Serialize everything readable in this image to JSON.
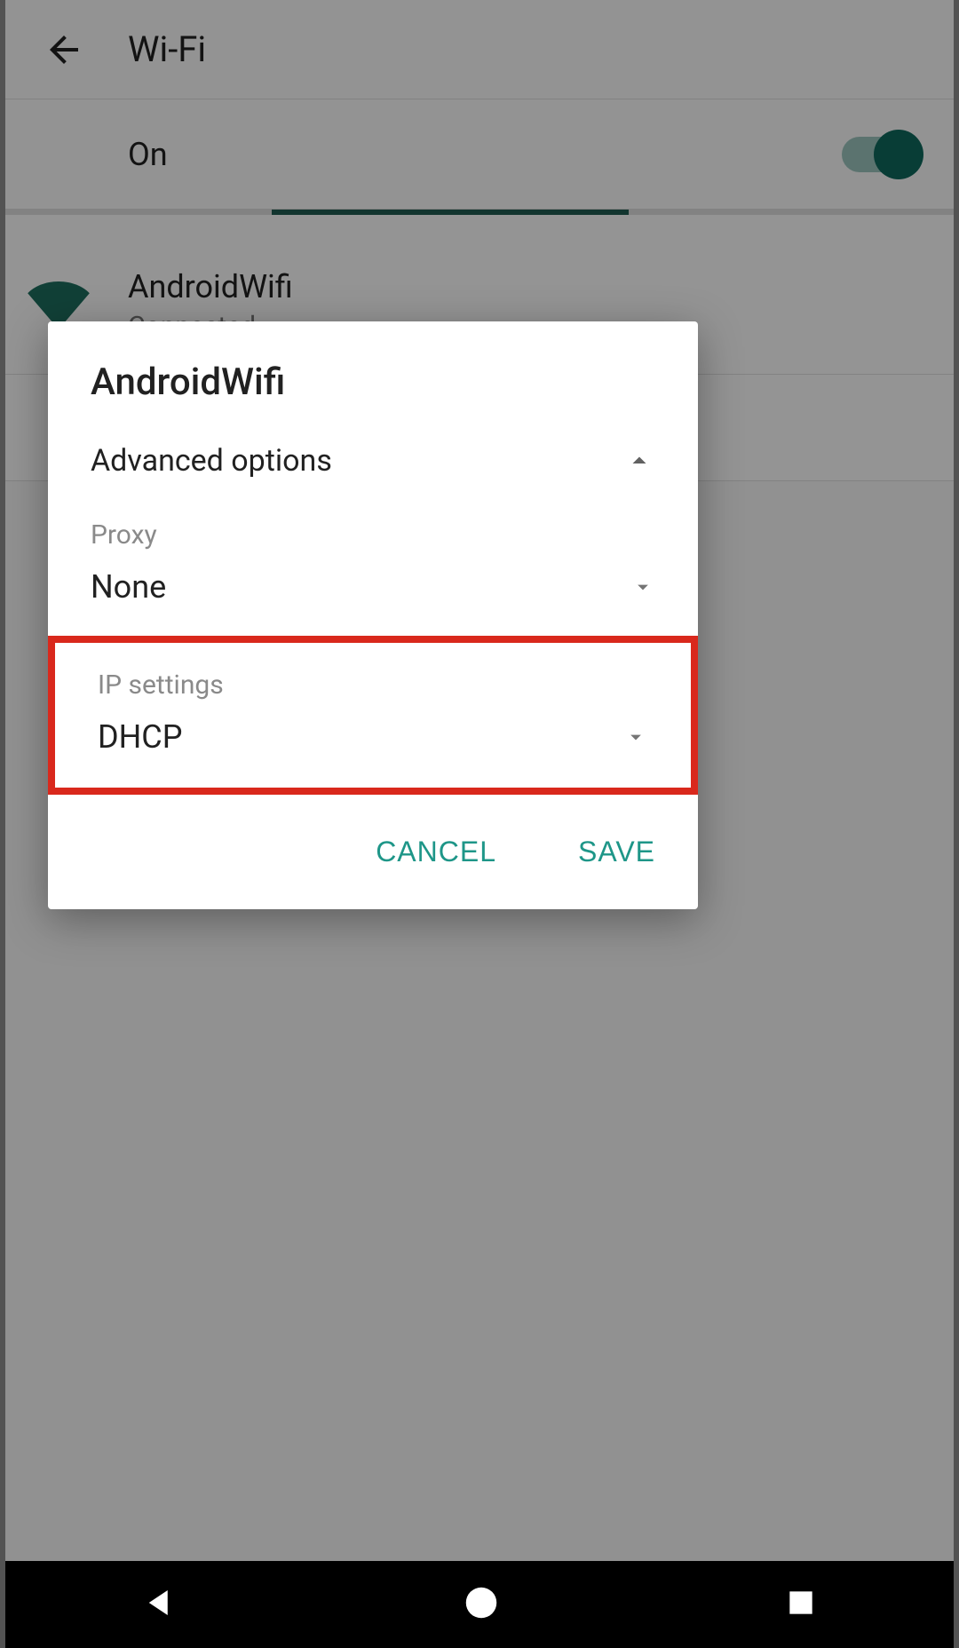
{
  "appbar": {
    "title": "Wi-Fi"
  },
  "wifi": {
    "state_label": "On",
    "network": {
      "name": "AndroidWifi",
      "status": "Connected"
    }
  },
  "dialog": {
    "title": "AndroidWifi",
    "advanced_label": "Advanced options",
    "proxy": {
      "label": "Proxy",
      "value": "None"
    },
    "ip": {
      "label": "IP settings",
      "value": "DHCP"
    },
    "cancel": "CANCEL",
    "save": "SAVE"
  }
}
